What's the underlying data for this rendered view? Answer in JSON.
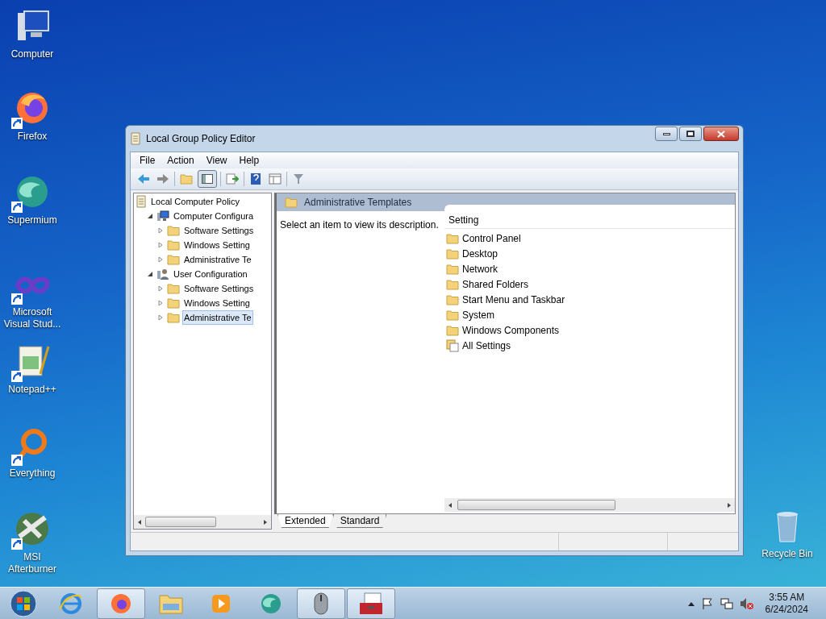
{
  "desktop_icons": [
    {
      "label": "Computer",
      "shortcut": false
    },
    {
      "label": "Firefox",
      "shortcut": true
    },
    {
      "label": "Supermium",
      "shortcut": true
    },
    {
      "label": "Microsoft Visual Stud...",
      "shortcut": true
    },
    {
      "label": "Notepad++",
      "shortcut": true
    },
    {
      "label": "Everything",
      "shortcut": true
    },
    {
      "label": "MSI Afterburner",
      "shortcut": true
    },
    {
      "label": "Recycle Bin",
      "shortcut": false
    }
  ],
  "window": {
    "title": "Local Group Policy Editor",
    "menu": [
      "File",
      "Action",
      "View",
      "Help"
    ],
    "tree": [
      {
        "label": "Local Computer Policy",
        "kind": "policy",
        "expanded": true,
        "selected": false,
        "children": [
          {
            "label": "Computer Configura",
            "kind": "computer",
            "expanded": true,
            "selected": false,
            "children": [
              {
                "label": "Software Settings",
                "kind": "folder",
                "expanded": false,
                "selected": false
              },
              {
                "label": "Windows Setting",
                "kind": "folder",
                "expanded": false,
                "selected": false
              },
              {
                "label": "Administrative Te",
                "kind": "folder",
                "expanded": false,
                "selected": false
              }
            ]
          },
          {
            "label": "User Configuration",
            "kind": "user",
            "expanded": true,
            "selected": false,
            "children": [
              {
                "label": "Software Settings",
                "kind": "folder",
                "expanded": false,
                "selected": false
              },
              {
                "label": "Windows Setting",
                "kind": "folder",
                "expanded": false,
                "selected": false
              },
              {
                "label": "Administrative Te",
                "kind": "folder",
                "expanded": false,
                "selected": true
              }
            ]
          }
        ]
      }
    ],
    "pane_title": "Administrative Templates",
    "description": "Select an item to view its description.",
    "column": "Setting",
    "items": [
      {
        "label": "Control Panel",
        "kind": "folder"
      },
      {
        "label": "Desktop",
        "kind": "folder"
      },
      {
        "label": "Network",
        "kind": "folder"
      },
      {
        "label": "Shared Folders",
        "kind": "folder"
      },
      {
        "label": "Start Menu and Taskbar",
        "kind": "folder"
      },
      {
        "label": "System",
        "kind": "folder"
      },
      {
        "label": "Windows Components",
        "kind": "folder"
      },
      {
        "label": "All Settings",
        "kind": "settings"
      }
    ],
    "tabs": [
      {
        "label": "Extended",
        "selected": true
      },
      {
        "label": "Standard",
        "selected": false
      }
    ]
  },
  "taskbar": {
    "buttons": [
      {
        "selected": false
      },
      {
        "selected": true
      },
      {
        "selected": false
      },
      {
        "selected": false
      },
      {
        "selected": false
      },
      {
        "selected": true
      },
      {
        "selected": true
      }
    ],
    "time": "3:55 AM",
    "date": "6/24/2024"
  }
}
